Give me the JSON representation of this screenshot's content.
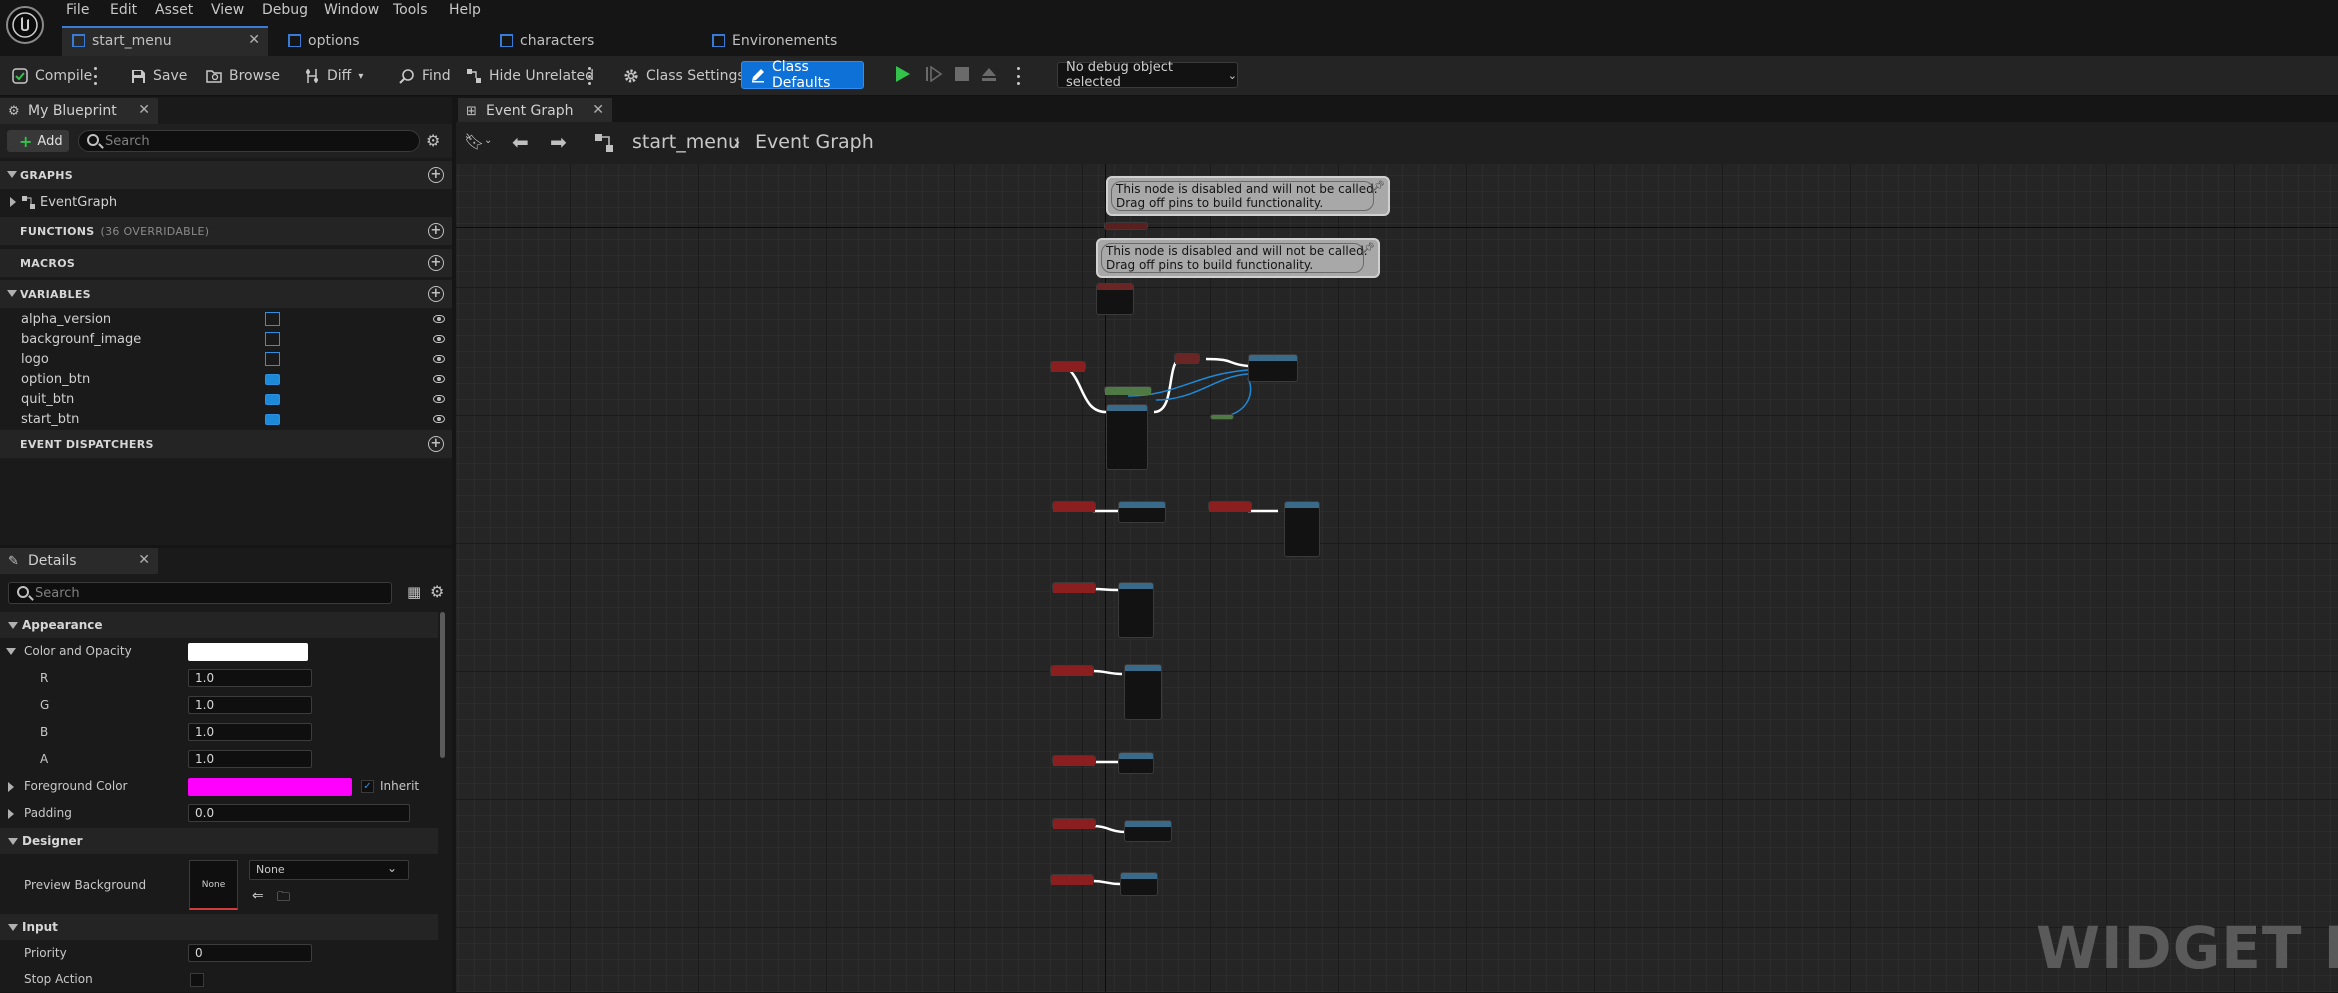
{
  "menu": {
    "items": [
      "File",
      "Edit",
      "Asset",
      "View",
      "Debug",
      "Window",
      "Tools",
      "Help"
    ]
  },
  "document_tabs": [
    {
      "label": "start_menu",
      "active": true
    },
    {
      "label": "options",
      "active": false
    },
    {
      "label": "characters",
      "active": false
    },
    {
      "label": "Environements",
      "active": false
    }
  ],
  "toolbar": {
    "compile": "Compile",
    "save": "Save",
    "browse": "Browse",
    "diff": "Diff",
    "find": "Find",
    "hide_unrelated": "Hide Unrelated",
    "class_settings": "Class Settings",
    "class_defaults": "Class Defaults",
    "debug_object": "No debug object selected"
  },
  "my_blueprint": {
    "tab_label": "My Blueprint",
    "add_label": "Add",
    "search_placeholder": "Search",
    "graphs_header": "GRAPHS",
    "event_graph": "EventGraph",
    "functions_header": "FUNCTIONS",
    "functions_sub": "(36 OVERRIDABLE)",
    "macros_header": "MACROS",
    "variables_header": "VARIABLES",
    "variables": [
      {
        "name": "alpha_version",
        "type": "image"
      },
      {
        "name": "backgrounf_image",
        "type": "image"
      },
      {
        "name": "logo",
        "type": "image"
      },
      {
        "name": "option_btn",
        "type": "button"
      },
      {
        "name": "quit_btn",
        "type": "button"
      },
      {
        "name": "start_btn",
        "type": "button"
      }
    ],
    "dispatchers_header": "EVENT DISPATCHERS"
  },
  "details": {
    "tab_label": "Details",
    "search_placeholder": "Search",
    "appearance": "Appearance",
    "color_and_opacity": "Color and Opacity",
    "r_label": "R",
    "r_value": "1.0",
    "g_label": "G",
    "g_value": "1.0",
    "b_label": "B",
    "b_value": "1.0",
    "a_label": "A",
    "a_value": "1.0",
    "foreground_color": "Foreground Color",
    "foreground_color_hex": "#ff00ff",
    "inherit_label": "Inherit",
    "padding": "Padding",
    "padding_value": "0.0",
    "designer": "Designer",
    "preview_background": "Preview Background",
    "preview_swatch": "None",
    "preview_select": "None",
    "input": "Input",
    "priority": "Priority",
    "priority_value": "0",
    "stop_action": "Stop Action"
  },
  "graph": {
    "tab_label": "Event Graph",
    "breadcrumb_root": "start_menu",
    "breadcrumb_current": "Event Graph",
    "comment_1_line1": "This node is disabled and will not be called.",
    "comment_1_line2": "Drag off pins to build functionality.",
    "comment_2_line1": "This node is disabled and will not be called.",
    "comment_2_line2": "Drag off pins to build functionality.",
    "watermark": "WIDGET BLU"
  },
  "colors": {
    "accent": "#0e71d8",
    "event_node": "#8b1f1f",
    "function_node": "#3a6a8a",
    "wire_exec": "#ffffff",
    "wire_object": "#1d8ad9",
    "foreground": "#ff00ff"
  }
}
